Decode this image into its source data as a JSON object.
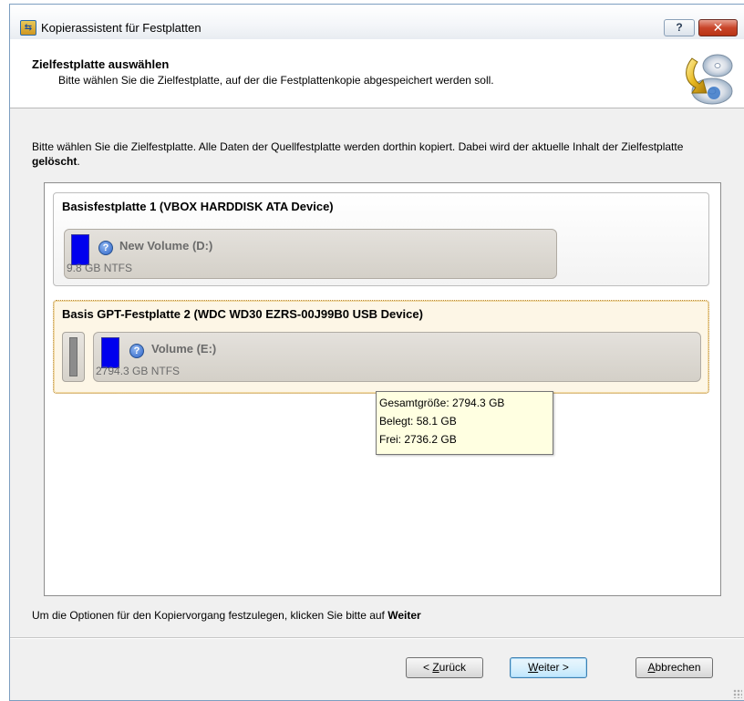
{
  "window": {
    "title": "Kopierassistent für Festplatten",
    "help_label": "?",
    "close_label": "✕"
  },
  "header": {
    "title": "Zielfestplatte auswählen",
    "subtitle": "Bitte wählen Sie die Zielfestplatte, auf der die Festplattenkopie abgespeichert werden soll."
  },
  "instruction": {
    "text_before": "Bitte wählen Sie die Zielfestplatte. Alle Daten der Quellfestplatte werden dorthin kopiert. Dabei wird der aktuelle Inhalt der Zielfestplatte ",
    "bold": "gelöscht",
    "text_after": "."
  },
  "disks": [
    {
      "title": "Basisfestplatte 1 (VBOX HARDDISK ATA Device)",
      "partition": {
        "name": "New Volume (D:)",
        "info": "9.8 GB NTFS"
      }
    },
    {
      "title": "Basis GPT-Festplatte 2 (WDC WD30 EZRS-00J99B0 USB Device)",
      "partition": {
        "name": "Volume (E:)",
        "info": "2794.3 GB NTFS"
      }
    }
  ],
  "tooltip": {
    "total": "Gesamtgröße: 2794.3 GB",
    "used": "Belegt: 58.1 GB",
    "free": "Frei: 2736.2 GB"
  },
  "footer": {
    "text": "Um die Optionen für den Kopiervorgang festzulegen, klicken Sie bitte auf ",
    "bold": "Weiter"
  },
  "buttons": {
    "back_prefix": "< ",
    "back_access": "Z",
    "back_rest": "urück",
    "next_access": "W",
    "next_rest": "eiter >",
    "cancel_access": "A",
    "cancel_rest": "bbrechen"
  },
  "colors": {
    "usage_bar": "#0000ee",
    "selected_disk_bg": "#fdf6e6",
    "tooltip_bg": "#ffffe1"
  }
}
